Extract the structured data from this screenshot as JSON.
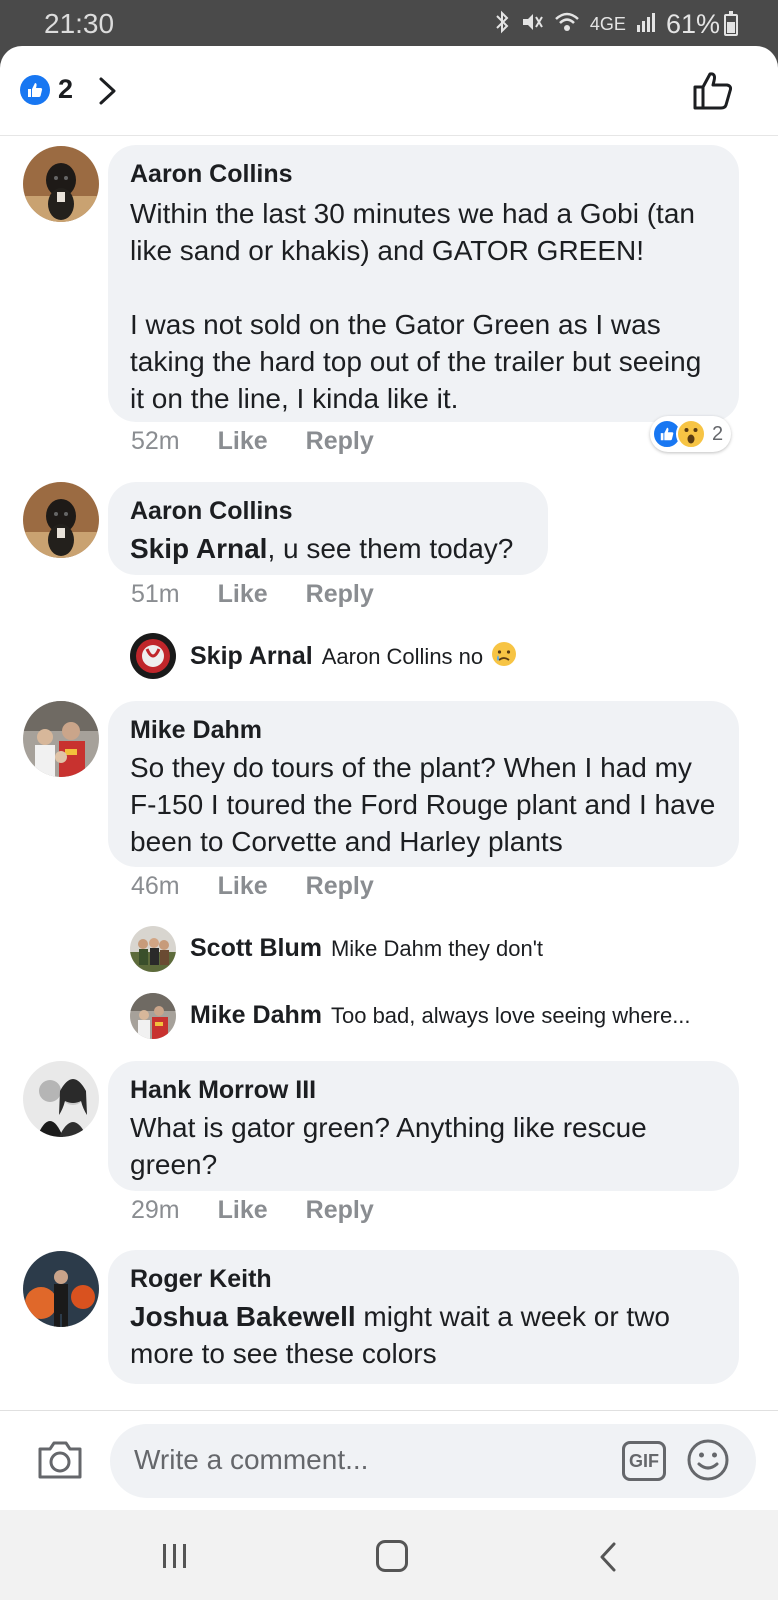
{
  "status_bar": {
    "time": "21:30",
    "network": "4GE",
    "battery": "61%",
    "icons": [
      "bluetooth-icon",
      "mute-icon",
      "wifi-icon",
      "signal-icon",
      "battery-icon"
    ]
  },
  "header": {
    "like_count": "2",
    "icons": [
      "like-badge-icon",
      "chevron-right-icon",
      "thumbs-up-icon"
    ],
    "accent": "#1877f2"
  },
  "comments": [
    {
      "author": "Aaron Collins",
      "text": "Within the last 30 minutes we had a Gobi (tan like sand or khakis) and GATOR GREEN!\n\nI was not sold on the Gator Green as I was taking the hard top out of the trailer but seeing it on the line, I kinda like it.",
      "time": "52m",
      "like": "Like",
      "reply": "Reply",
      "reaction_count": "2"
    },
    {
      "author": "Aaron Collins",
      "mention": "Skip Arnal",
      "text": ", u see them today?",
      "time": "51m",
      "like": "Like",
      "reply": "Reply",
      "replies": [
        {
          "author": "Skip Arnal",
          "text": "Aaron Collins no",
          "emoji": "crying-face"
        }
      ]
    },
    {
      "author": "Mike Dahm",
      "text": "So they do tours of the plant?  When I had my F-150 I toured the Ford Rouge plant and I have been to Corvette and Harley plants",
      "time": "46m",
      "like": "Like",
      "reply": "Reply",
      "replies": [
        {
          "author": "Scott Blum",
          "text": "Mike Dahm they don't"
        },
        {
          "author": "Mike Dahm",
          "text": "Too bad, always love seeing where..."
        }
      ]
    },
    {
      "author": "Hank Morrow III",
      "text": "What is gator green?  Anything like rescue green?",
      "time": "29m",
      "like": "Like",
      "reply": "Reply"
    },
    {
      "author": "Roger Keith",
      "mention": "Joshua Bakewell",
      "text": " might wait a week or two more to see these colors"
    }
  ],
  "composer": {
    "placeholder": "Write a comment...",
    "gif_label": "GIF",
    "icons": [
      "camera-icon",
      "gif-icon",
      "emoji-icon"
    ]
  },
  "nav_bar": {
    "icons": [
      "recents-icon",
      "home-icon",
      "back-icon"
    ]
  }
}
